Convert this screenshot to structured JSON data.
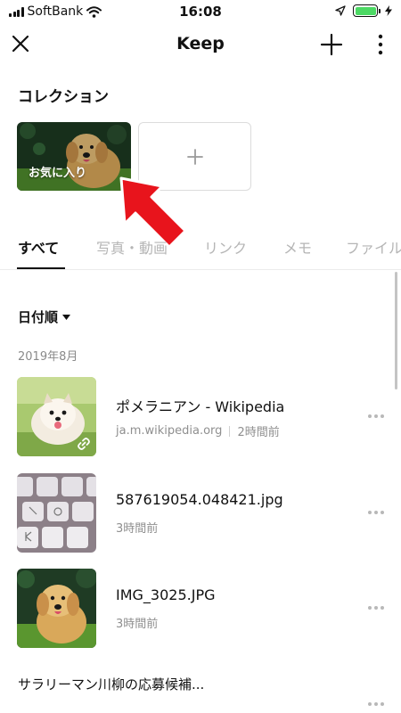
{
  "status_bar": {
    "carrier": "SoftBank",
    "time": "16:08",
    "battery_level": 1.0,
    "battery_color": "#4cd964"
  },
  "nav": {
    "title": "Keep",
    "close_icon": "close-icon",
    "add_icon": "plus-icon",
    "more_icon": "vertical-ellipsis-icon"
  },
  "collections": {
    "section_title": "コレクション",
    "items": [
      {
        "label": "お気に入り",
        "thumbnail": "golden-retriever-puppy-photo"
      }
    ],
    "add_icon": "plus-icon"
  },
  "annotation": {
    "arrow_color": "#e8141c",
    "arrow_icon": "red-arrow-pointer"
  },
  "tabs": [
    {
      "label": "すべて",
      "active": true
    },
    {
      "label": "写真・動画",
      "active": false
    },
    {
      "label": "リンク",
      "active": false
    },
    {
      "label": "メモ",
      "active": false
    },
    {
      "label": "ファイル",
      "active": false
    }
  ],
  "list": {
    "sort_label": "日付順",
    "date_group": "2019年8月",
    "items": [
      {
        "title": "ポメラニアン - Wikipedia",
        "source": "ja.m.wikipedia.org",
        "time": "2時間前",
        "thumbnail": "pomeranian-photo",
        "badge_icon": "link-icon"
      },
      {
        "title": "587619054.048421.jpg",
        "time": "3時間前",
        "thumbnail": "keyboard-keys-photo"
      },
      {
        "title": "IMG_3025.JPG",
        "time": "3時間前",
        "thumbnail": "golden-retriever-puppy-photo"
      },
      {
        "title": "サラリーマン川柳の応募候補..."
      }
    ]
  }
}
